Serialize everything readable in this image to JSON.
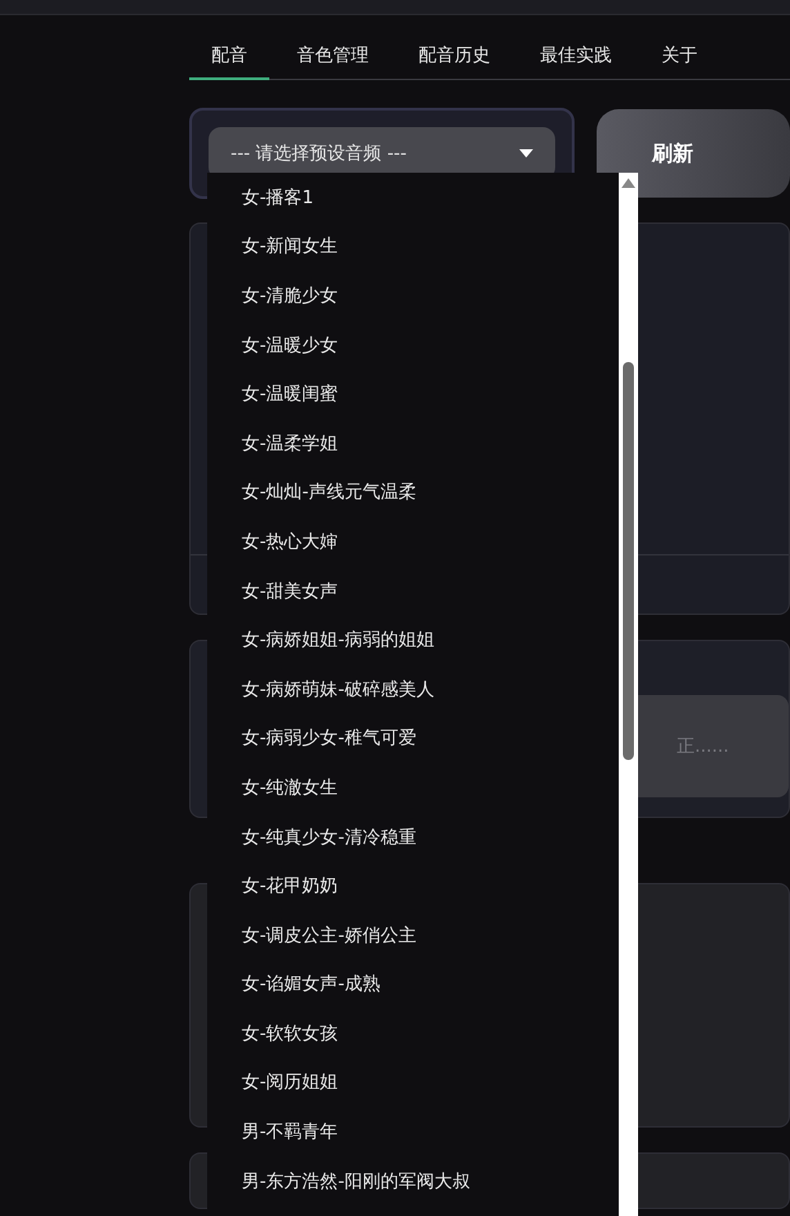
{
  "tabs": [
    {
      "label": "配音",
      "selected": true
    },
    {
      "label": "音色管理",
      "selected": false
    },
    {
      "label": "配音历史",
      "selected": false
    },
    {
      "label": "最佳实践",
      "selected": false
    },
    {
      "label": "关于",
      "selected": false
    }
  ],
  "preset_select": {
    "placeholder": "--- 请选择预设音频 ---",
    "expanded": true
  },
  "refresh_button": "刷新",
  "text_input": {
    "placeholder": "正......"
  },
  "options": [
    {
      "label": "女-播客1",
      "selected": false
    },
    {
      "label": "女-新闻女生",
      "selected": false
    },
    {
      "label": "女-清脆少女",
      "selected": false
    },
    {
      "label": "女-温暖少女",
      "selected": false
    },
    {
      "label": "女-温暖闺蜜",
      "selected": false
    },
    {
      "label": "女-温柔学姐",
      "selected": false
    },
    {
      "label": "女-灿灿-声线元气温柔",
      "selected": false
    },
    {
      "label": "女-热心大婶",
      "selected": false
    },
    {
      "label": "女-甜美女声",
      "selected": false
    },
    {
      "label": "女-病娇姐姐-病弱的姐姐",
      "selected": false
    },
    {
      "label": "女-病娇萌妹-破碎感美人",
      "selected": false
    },
    {
      "label": "女-病弱少女-稚气可爱",
      "selected": false
    },
    {
      "label": "女-纯澈女生",
      "selected": false
    },
    {
      "label": "女-纯真少女-清冷稳重",
      "selected": false
    },
    {
      "label": "女-花甲奶奶",
      "selected": false
    },
    {
      "label": "女-调皮公主-娇俏公主",
      "selected": false
    },
    {
      "label": "女-谄媚女声-成熟",
      "selected": false
    },
    {
      "label": "女-软软女孩",
      "selected": false
    },
    {
      "label": "女-阅历姐姐",
      "selected": false
    },
    {
      "label": "男-不羁青年",
      "selected": false
    },
    {
      "label": "男-东方浩然-阳刚的军阀大叔",
      "selected": false
    }
  ]
}
